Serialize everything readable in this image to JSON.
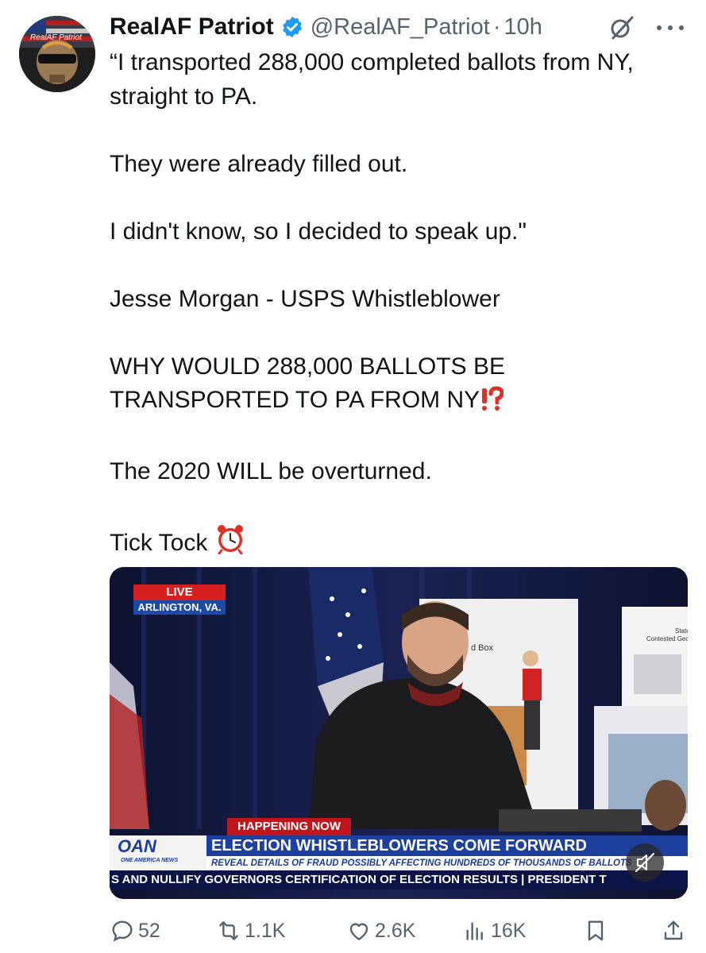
{
  "tweet": {
    "display_name": "RealAF Patriot",
    "handle": "@RealAF_Patriot",
    "separator": "·",
    "time": "10h",
    "avatar_text": "RealAF Patriot",
    "paragraphs": [
      "“I transported 288,000 completed ballots from NY, straight to PA.",
      "They were already filled out.",
      "I didn't know, so I decided to speak up.\"",
      "Jesse Morgan - USPS Whistleblower",
      "WHY WOULD 288,000 BALLOTS BE TRANSPORTED TO PA FROM NY",
      "The 2020 WILL be overturned.",
      "Tick Tock"
    ],
    "emojis": {
      "interrobang": "⁉️",
      "alarm_clock": "⏰"
    }
  },
  "media": {
    "live_label": "LIVE",
    "location_label": "ARLINGTON, VA.",
    "happening_label": "HAPPENING NOW",
    "network_logo": "OAN",
    "network_sub": "ONE AMERICA NEWS",
    "headline": "ELECTION WHISTLEBLOWERS COME FORWARD",
    "subheadline": "REVEAL DETAILS OF FRAUD POSSIBLY AFFECTING HUNDREDS OF THOUSANDS OF BALLOTS",
    "ticker": "S AND NULLIFY GOVERNORS CERTIFICATION OF ELECTION RESULTS | PRESIDENT T",
    "poster_text_1": "d Box",
    "poster_text_2": "State",
    "poster_text_3": "Contested Geo"
  },
  "actions": {
    "replies": "52",
    "reposts": "1.1K",
    "likes": "2.6K",
    "views": "16K"
  },
  "colors": {
    "text": "#0f1419",
    "secondary": "#536471",
    "verified": "#1d9bf0",
    "oan_blue": "#1d3f9e",
    "live_red": "#d61f1f"
  },
  "icons": [
    "verified-badge-icon",
    "grok-icon",
    "more-icon",
    "reply-icon",
    "repost-icon",
    "like-icon",
    "views-icon",
    "bookmark-icon",
    "share-icon",
    "mute-icon"
  ]
}
